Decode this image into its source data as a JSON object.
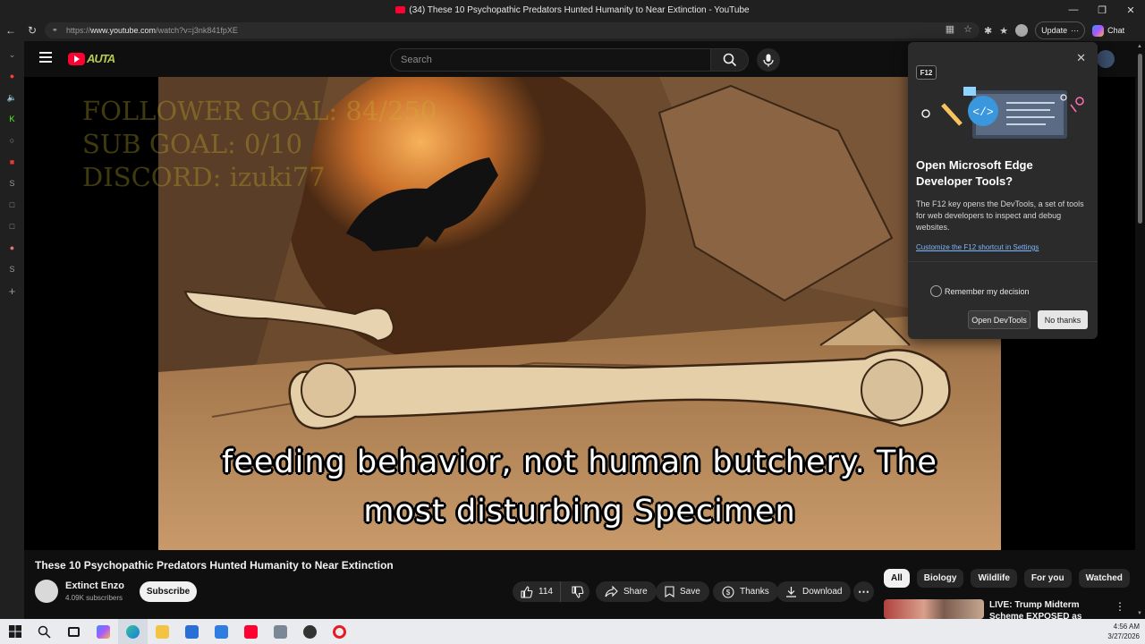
{
  "window": {
    "title": "(34) These 10 Psychopathic Predators Hunted Humanity to Near Extinction - YouTube",
    "controls": [
      "—",
      "❐",
      "✕"
    ]
  },
  "browser": {
    "url_prefix": "https://",
    "url_host": "www.youtube.com",
    "url_path": "/watch?v=j3nk841fpXE",
    "update_label": "Update",
    "chat_label": "Chat"
  },
  "youtube": {
    "search_placeholder": "Search",
    "logo_text": "AUTA"
  },
  "video": {
    "overlay_lines": [
      "FOLLOWER GOAL: 84/250",
      "SUB GOAL: 0/10",
      "DISCORD: izuki77"
    ],
    "caption_lines": [
      "feeding behavior, not human butchery. The",
      "most disturbing Specimen"
    ],
    "title": "These 10 Psychopathic Predators Hunted Humanity to Near Extinction",
    "channel_name": "Extinct Enzo",
    "subscribers": "4.09K subscribers",
    "subscribe_label": "Subscribe",
    "like_count": "114",
    "share_label": "Share",
    "save_label": "Save",
    "thanks_label": "Thanks",
    "download_label": "Download"
  },
  "chips": [
    "All",
    "Biology",
    "Wildlife",
    "For you",
    "Watched"
  ],
  "recommendation": {
    "title": "LIVE: Trump Midterm Scheme EXPOSED as EVERYTHING"
  },
  "devtools_popup": {
    "key": "F12",
    "heading": "Open Microsoft Edge Developer Tools?",
    "description": "The F12 key opens the DevTools, a set of tools for web developers to inspect and debug websites.",
    "link": "Customize the F12 shortcut in Settings",
    "remember": "Remember my decision",
    "open_label": "Open DevTools",
    "no_label": "No thanks"
  },
  "taskbar": {
    "time": "4:56 AM",
    "date": "3/27/2026"
  },
  "colors": {
    "youtube_red": "#ff0033",
    "background": "#0f0f0f",
    "link_blue": "#7cb7ff"
  }
}
